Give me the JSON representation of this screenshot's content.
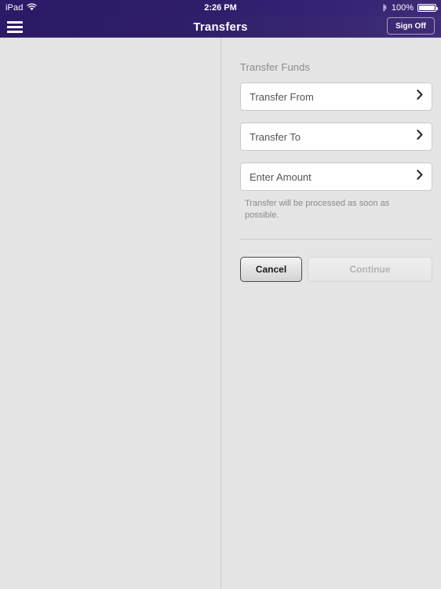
{
  "status_bar": {
    "device": "iPad",
    "wifi_icon": "wifi-icon",
    "time": "2:26 PM",
    "bluetooth_icon": "bluetooth-icon",
    "battery_percent": "100%",
    "battery_icon": "battery-full-icon"
  },
  "nav_bar": {
    "menu_icon": "hamburger-menu-icon",
    "title": "Transfers",
    "sign_off_label": "Sign Off"
  },
  "form": {
    "section_title": "Transfer Funds",
    "fields": [
      {
        "label": "Transfer From",
        "chevron_icon": "chevron-right-icon"
      },
      {
        "label": "Transfer To",
        "chevron_icon": "chevron-right-icon"
      },
      {
        "label": "Enter Amount",
        "chevron_icon": "chevron-right-icon"
      }
    ],
    "helper_text": "Transfer will be processed as soon as possible.",
    "cancel_label": "Cancel",
    "continue_label": "Continue"
  },
  "colors": {
    "nav_purple_dark": "#2b1a66",
    "nav_purple_light": "#3f2d78",
    "page_background": "#e5e5e5",
    "field_background": "#ffffff",
    "muted_text": "#8a8a8a"
  }
}
